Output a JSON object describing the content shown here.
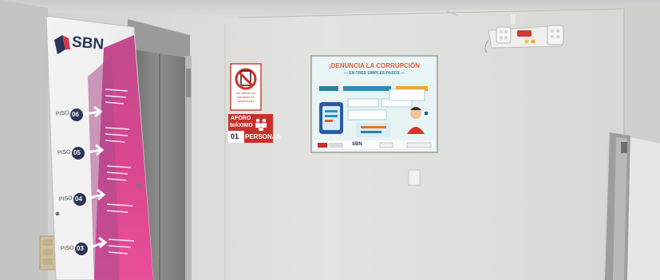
{
  "directory_board": {
    "logo": "SBN",
    "floor_prefix": "PISO",
    "floors": [
      "06",
      "05",
      "04",
      "03"
    ]
  },
  "no_phone_sign": {
    "caption": "No utilizar los celulares en ascensores"
  },
  "capacity_sign": {
    "line1": "AFORO",
    "line2": "MÁXIMO",
    "count": "01",
    "unit": "PERSONAS"
  },
  "poster": {
    "title": "¡DENUNCIA LA CORRUPCIÓN",
    "subtitle": "— EN TRES SIMPLES PASOS —",
    "footer_logo": "SBN"
  }
}
